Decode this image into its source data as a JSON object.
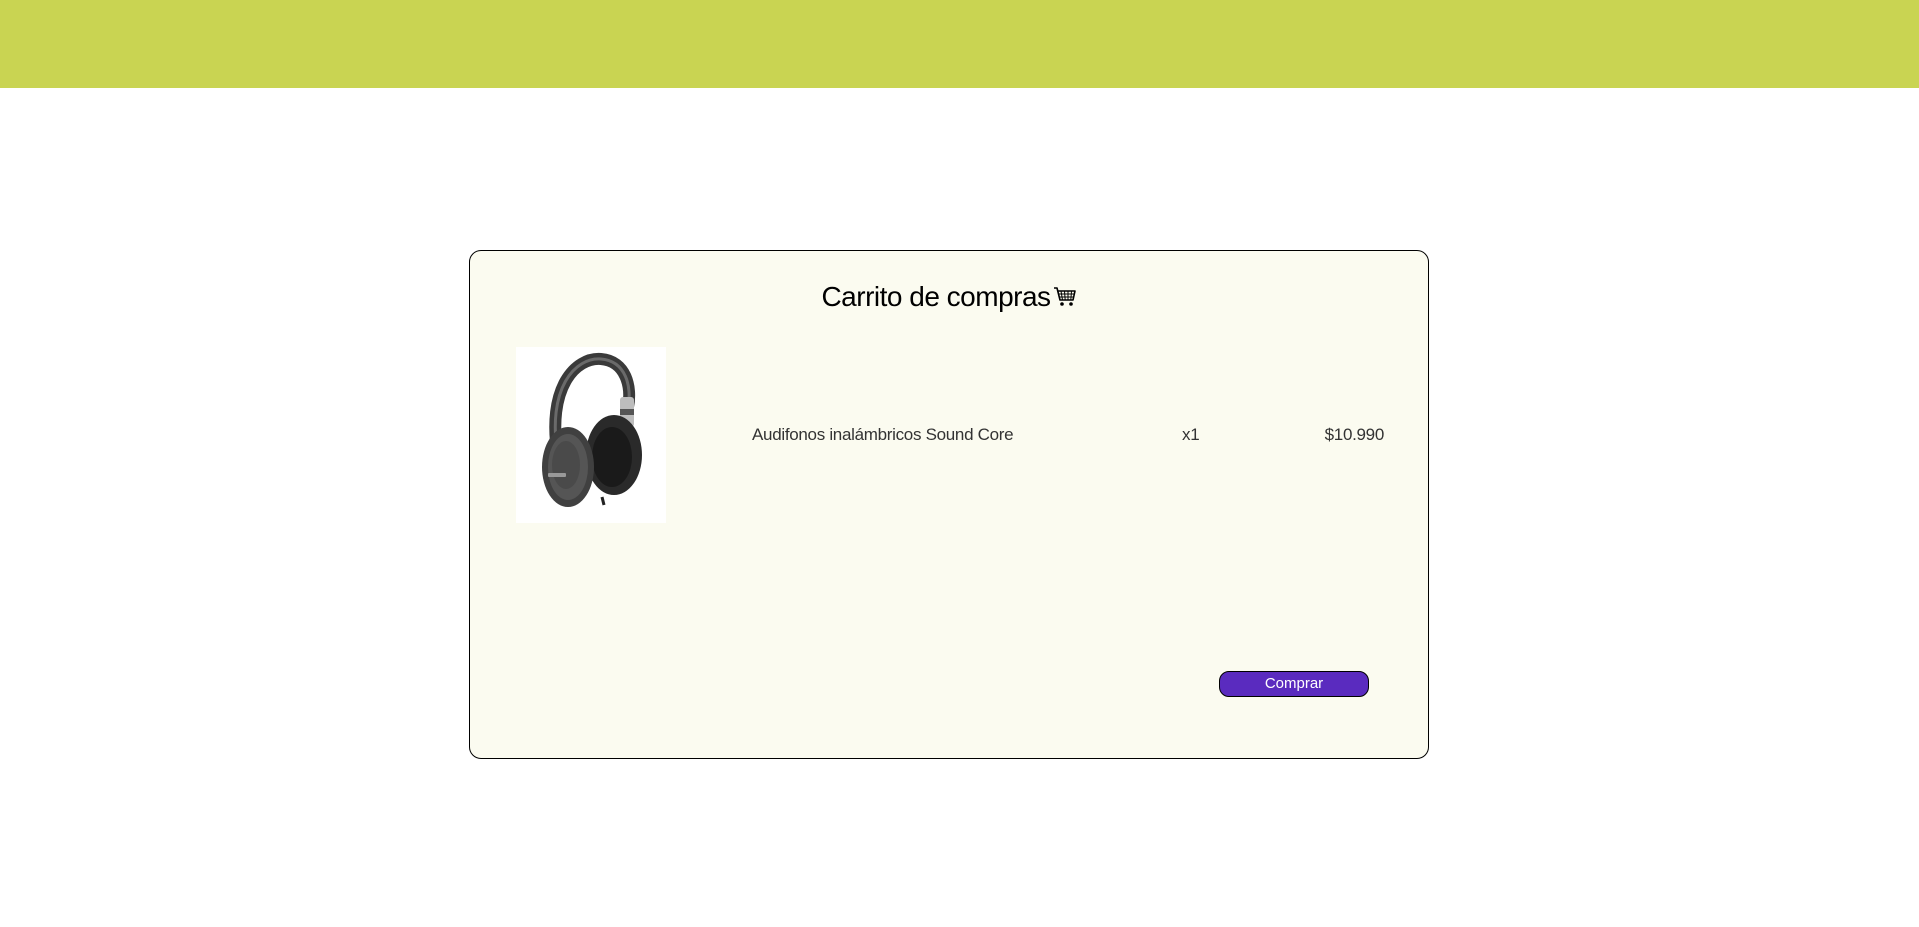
{
  "header": {
    "color": "#c9d452"
  },
  "cart": {
    "title": "Carrito de compras",
    "title_icon": "shopping-cart-icon",
    "items": [
      {
        "image_icon": "headphones-product-image",
        "name": "Audifonos inalámbricos Sound Core",
        "quantity": "x1",
        "price": "$10.990"
      }
    ],
    "buy_label": "Comprar",
    "buy_color": "#5a2bbf",
    "card_background": "#fbfbf0"
  }
}
